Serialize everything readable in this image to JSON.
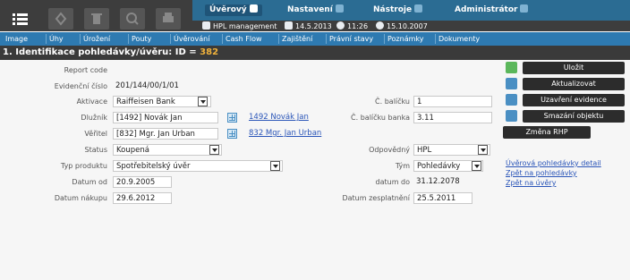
{
  "menu": {
    "items": [
      {
        "label": "Úvěrový"
      },
      {
        "label": "Nastavení"
      },
      {
        "label": "Nástroje"
      },
      {
        "label": "Administrátor"
      }
    ]
  },
  "toolbar_icons": [
    "list-icon",
    "refresh-icon",
    "delete-icon",
    "search-icon",
    "print-icon"
  ],
  "info": {
    "user": "HPL management",
    "date": "14.5.2013",
    "time": "11:26",
    "date2": "15.10.2007"
  },
  "tabs": [
    "Image",
    "Úhy",
    "Úrožení",
    "Pouty",
    "Úvěrování",
    "Cash Flow",
    "Zajištění",
    "Právní stavy",
    "Poznámky",
    "Dokumenty"
  ],
  "section": {
    "title": "1. Identifikace pohledávky/úvěru: ID = ",
    "id": "382"
  },
  "form": {
    "report_code_label": "Report code",
    "evidencni_label": "Evidenční číslo",
    "evidencni_value": "201/144/00/1/01",
    "aktivace_label": "Aktivace",
    "aktivace_value": "Raiffeisen Bank",
    "dluznik_label": "Dlužník",
    "dluznik_value": "[1492] Novák Jan",
    "dluznik_link": "1492 Novák Jan",
    "veritel_label": "Věřitel",
    "veritel_value": "[832] Mgr. Jan Urban",
    "veritel_link": "832 Mgr. Jan Urban",
    "status_label": "Status",
    "status_value": "Koupená",
    "typ_label": "Typ produktu",
    "typ_value": "Spotřebitelský úvěr",
    "datum_od_label": "Datum od",
    "datum_od_value": "20.9.2005",
    "datum_nakupu_label": "Datum nákupu",
    "datum_nakupu_value": "29.6.2012",
    "c_balicku_label": "Č. balíčku",
    "c_balicku_value": "1",
    "c_balicku_banka_label": "Č. balíčku banka",
    "c_balicku_banka_value": "3.11",
    "odpovedny_label": "Odpovědný",
    "odpovedny_value": "HPL",
    "tym_label": "Tým",
    "tym_value": "Pohledávky",
    "datum_do_label": "datum do",
    "datum_do_value": "31.12.2078",
    "datum_zesplatneni_label": "Datum zesplatnění",
    "datum_zesplatneni_value": "25.5.2011"
  },
  "actions": {
    "buttons": [
      "Uložit",
      "Aktualizovat",
      "Uzavření evidence",
      "Smazání objektu",
      "Změna RHP"
    ],
    "links": [
      "Úvěrová pohledávky detail",
      "Zpět na pohledávky",
      "Zpět na úvěry"
    ]
  },
  "colors": {
    "accent": "#2b6c93",
    "tabbar": "#2e7ab1",
    "header_dark": "#3a3a3a",
    "id_highlight": "#f0b23c"
  }
}
